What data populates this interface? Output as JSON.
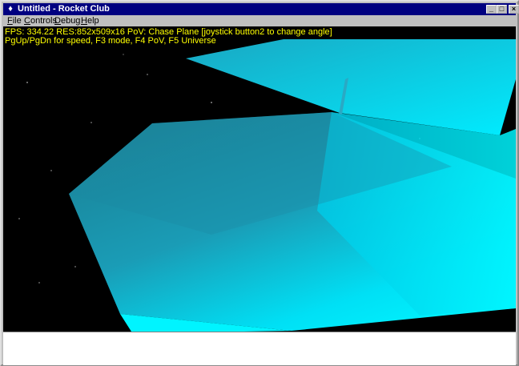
{
  "window": {
    "title": "Untitled - Rocket Club",
    "minimize_glyph": "_",
    "maximize_glyph": "□",
    "close_glyph": "×"
  },
  "menu": {
    "items": [
      {
        "label": "File",
        "accel": "F"
      },
      {
        "label": "Controls",
        "accel": "C"
      },
      {
        "label": "Debug",
        "accel": "D"
      },
      {
        "label": "Help",
        "accel": "H"
      }
    ]
  },
  "hud": {
    "line1": "FPS:  334.22  RES:852x509x16   PoV: Chase Plane [joystick button2 to change angle]",
    "line2": "PgUp/PgDn for speed, F3 mode, F4 PoV, F5 Universe"
  },
  "colors": {
    "hud_text": "#ffff00",
    "title_bar": "#000080",
    "sky": "#000000",
    "hull_light": "#00f0ff",
    "hull_dark": "#1b7f93"
  },
  "icons": {
    "app": "rocket-app-icon"
  }
}
